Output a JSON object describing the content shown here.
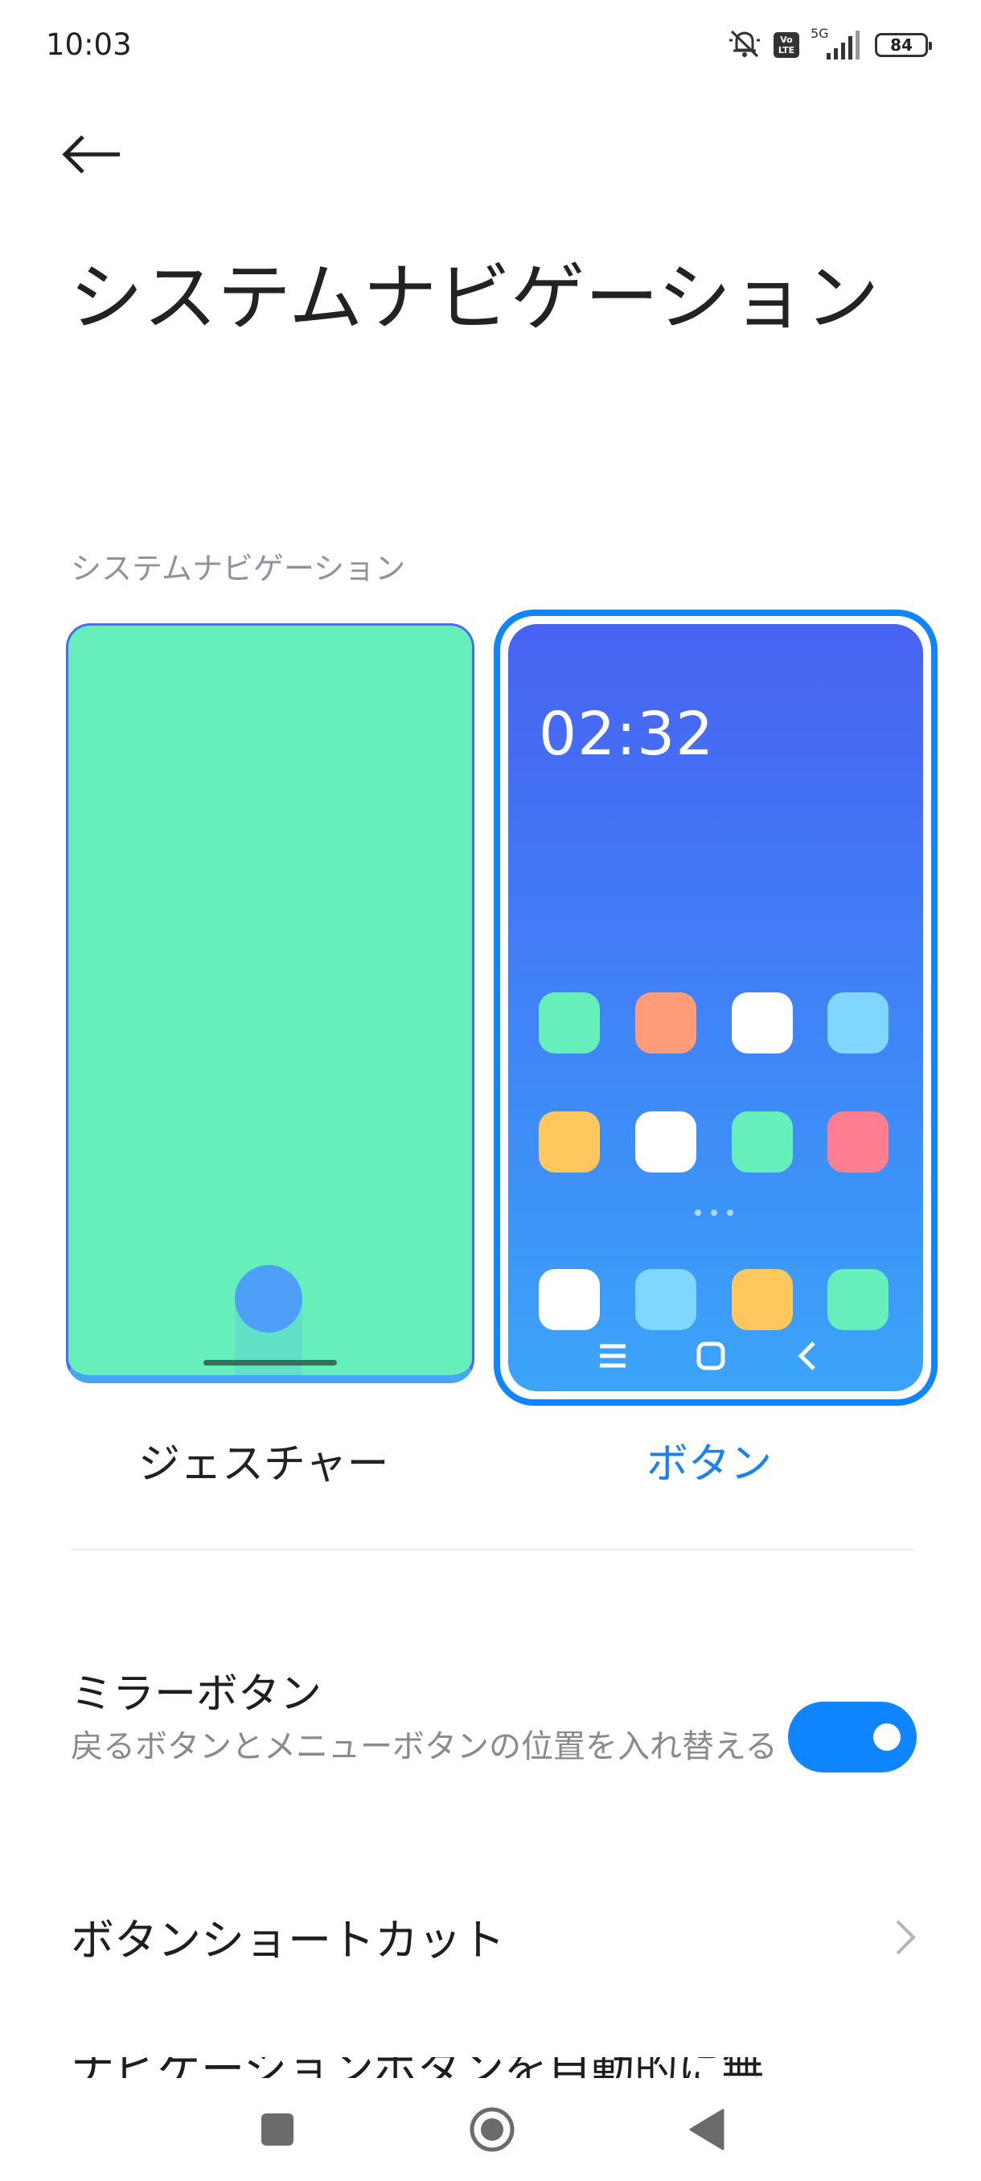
{
  "status_bar": {
    "time": "10:03",
    "network": "5G",
    "volte": "Vo\nLTE",
    "battery": "84",
    "icons": [
      "silent-icon",
      "volte-icon",
      "signal-icon",
      "battery-icon"
    ]
  },
  "header": {
    "back_icon": "arrow-left-icon",
    "title": "システムナビゲーション"
  },
  "section": {
    "label": "システムナビゲーション"
  },
  "options": {
    "gesture_label": "ジェスチャー",
    "buttons_label": "ボタン",
    "selected": "buttons"
  },
  "preview": {
    "clock": "02:32",
    "app_colors": [
      "#67efbb",
      "#ff9d7a",
      "#ffffff",
      "#7fd6ff",
      "#ffc75e",
      "#ffffff",
      "#67efbb",
      "#ff7e8f",
      "#ffffff",
      "#7fd6ff",
      "#ffc75e",
      "#67efbb"
    ]
  },
  "mirror_buttons": {
    "title": "ミラーボタン",
    "description": "戻るボタンとメニューボタンの位置を入れ替える",
    "enabled": true
  },
  "button_shortcut": {
    "label": "ボタンショートカット"
  },
  "partial_row": {
    "label": "ナビゲーションボタンを自動的に無"
  },
  "colors": {
    "accent": "#0f86ff",
    "gesture_preview": "#67efbb"
  }
}
